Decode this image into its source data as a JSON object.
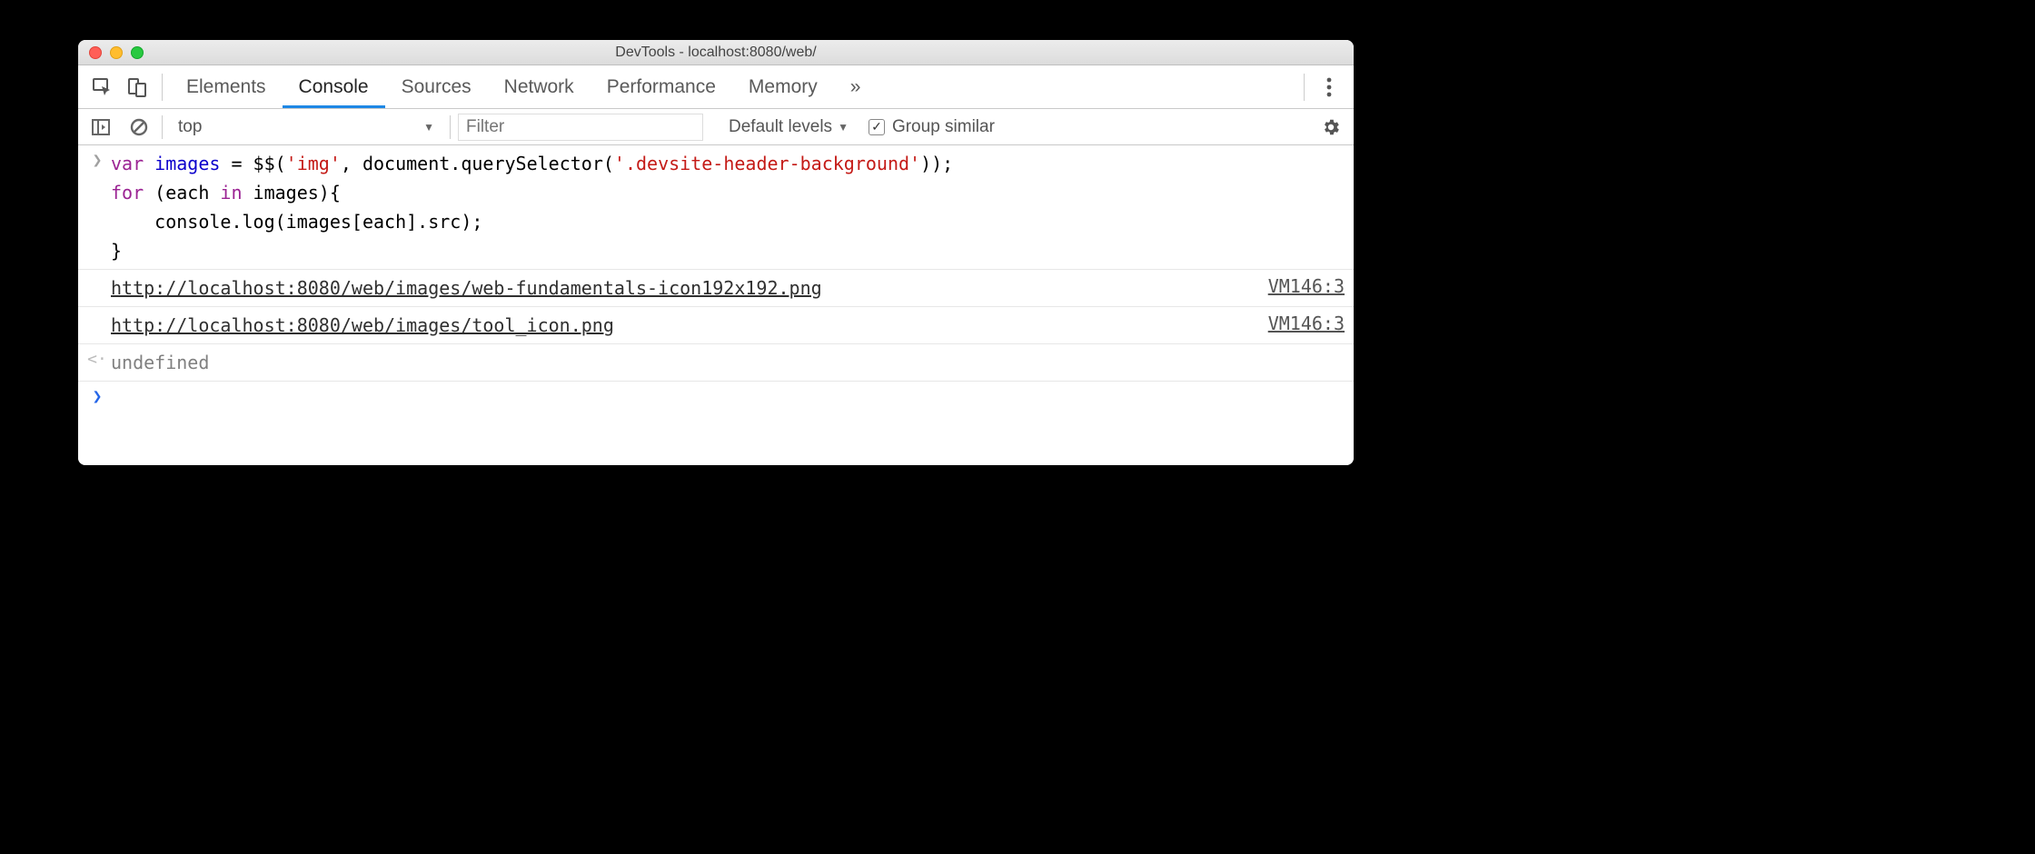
{
  "window": {
    "title": "DevTools - localhost:8080/web/"
  },
  "tabs": {
    "elements": "Elements",
    "console": "Console",
    "sources": "Sources",
    "network": "Network",
    "performance": "Performance",
    "memory": "Memory",
    "overflow": "»"
  },
  "toolbar": {
    "context": "top",
    "filter_placeholder": "Filter",
    "levels": "Default levels",
    "group_similar": "Group similar"
  },
  "code": {
    "kw_var": "var",
    "ident_images": "images",
    "eq": " = $$(",
    "str_img": "'img'",
    "comma": ", document.querySelector(",
    "str_sel": "'.devsite-header-background'",
    "close1": "));",
    "kw_for": "for",
    "for_open": " (each ",
    "kw_in": "in",
    "for_rest": " images){",
    "indent": "    console.log(images[each].src);",
    "brace": "}"
  },
  "logs": [
    {
      "text": "http://localhost:8080/web/images/web-fundamentals-icon192x192.png",
      "source": "VM146:3"
    },
    {
      "text": "http://localhost:8080/web/images/tool_icon.png",
      "source": "VM146:3"
    }
  ],
  "return_value": "undefined"
}
